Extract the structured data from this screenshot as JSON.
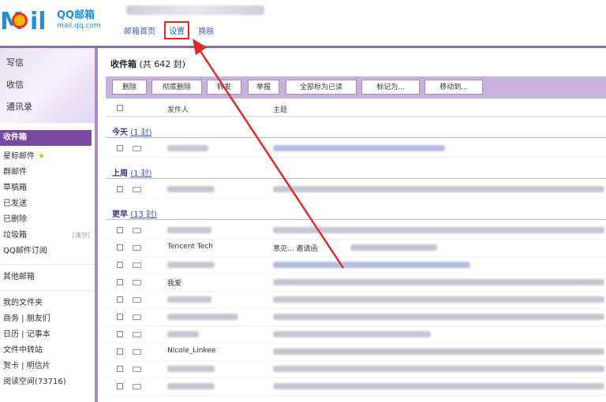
{
  "header": {
    "brand": "QQ邮箱",
    "brand_sub": "mail.qq.com",
    "links": [
      "邮箱首页",
      "设置",
      "换肤"
    ]
  },
  "sidebar": {
    "top_items": [
      "写信",
      "收信",
      "通讯录"
    ],
    "items": [
      {
        "label": "收件箱",
        "active": true
      },
      {
        "label": "星标邮件",
        "star": true
      },
      {
        "label": "群邮件"
      },
      {
        "label": "草稿箱"
      },
      {
        "label": "已发送"
      },
      {
        "label": "已删除"
      },
      {
        "label": "垃圾箱",
        "badge": "[清空]"
      },
      {
        "label": "QQ邮件订阅"
      },
      {
        "label": "其他邮箱"
      },
      {
        "label": "我的文件夹"
      },
      {
        "label": "商务 | 朋友们"
      },
      {
        "label": "日历 | 记事本"
      },
      {
        "label": "文件中转站"
      },
      {
        "label": "贺卡 | 明信片"
      },
      {
        "label": "阅读空间(73716)"
      }
    ]
  },
  "main": {
    "inbox_title": "收件箱",
    "inbox_count": "(共 642 封)",
    "toolbar": [
      "删除",
      "彻底删除",
      "转发",
      "举报",
      "全部标为已读",
      "标记为...",
      "移动到..."
    ],
    "columns": {
      "sender": "发件人",
      "subject": "主题"
    },
    "groups": [
      {
        "label": "今天",
        "count": "(1 封)"
      },
      {
        "label": "上周",
        "count": "(1 封)"
      },
      {
        "label": "更早",
        "count": "(13 封)"
      }
    ],
    "visible_senders": [
      "Tencent Tech",
      "我爱",
      "Nicole_Linkee"
    ],
    "visible_subjects": [
      "意见... 邀请函"
    ]
  },
  "colors": {
    "accent": "#7a4aa3",
    "toolbar": "#c8b2dd",
    "highlight": "#e22222",
    "link": "#3a5fb8"
  }
}
